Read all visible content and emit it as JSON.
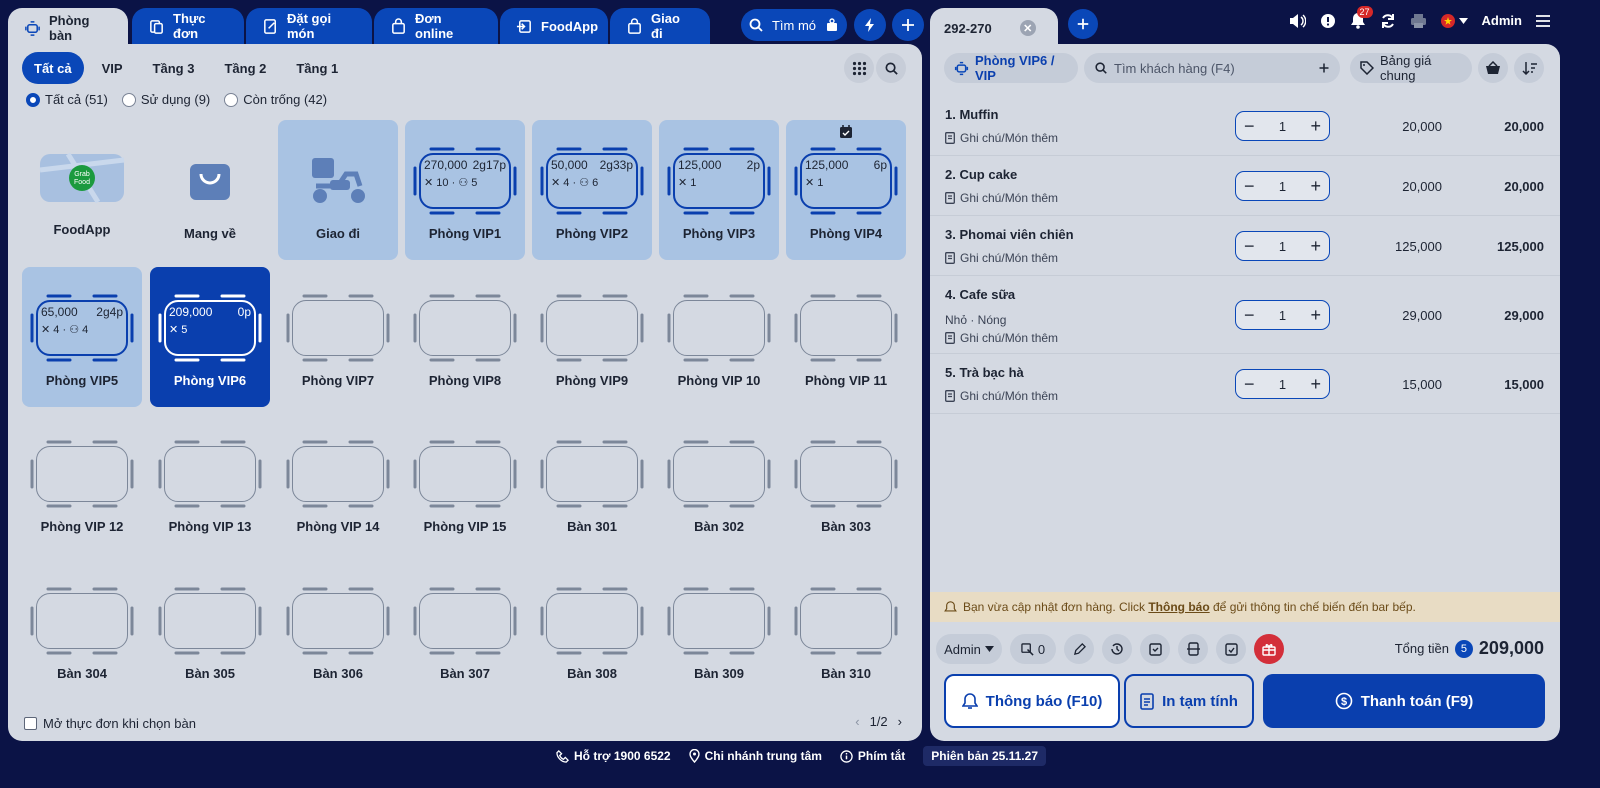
{
  "top_tabs": [
    {
      "label": "Phòng bàn",
      "icon": "table-icon"
    },
    {
      "label": "Thực đơn",
      "icon": "menu-icon"
    },
    {
      "label": "Đặt gọi món",
      "icon": "order-icon"
    },
    {
      "label": "Đơn online",
      "icon": "bag-icon"
    },
    {
      "label": "FoodApp",
      "icon": "login-icon"
    },
    {
      "label": "Giao đi",
      "icon": "bag-icon"
    }
  ],
  "search": {
    "label": "Tìm mó"
  },
  "floor_filters": [
    "Tất cả",
    "VIP",
    "Tầng 3",
    "Tầng 2",
    "Tầng 1"
  ],
  "status_filters": [
    {
      "label": "Tất cả (51)",
      "selected": true
    },
    {
      "label": "Sử dụng (9)",
      "selected": false
    },
    {
      "label": "Còn trống (42)",
      "selected": false
    }
  ],
  "special_cards": [
    {
      "name": "FoodApp",
      "icon": "grabfood-icon",
      "logo_text": "Grab Food"
    },
    {
      "name": "Mang về",
      "icon": "shopping-bag-icon"
    },
    {
      "name": "Giao đi",
      "icon": "scooter-icon"
    }
  ],
  "occupied_tables": [
    {
      "name": "Phòng VIP1",
      "amount": "270,000",
      "duration": "2g17p",
      "items": "10",
      "guests": "5"
    },
    {
      "name": "Phòng VIP2",
      "amount": "50,000",
      "duration": "2g33p",
      "items": "4",
      "guests": "6"
    },
    {
      "name": "Phòng VIP3",
      "amount": "125,000",
      "duration": "2p",
      "items": "1",
      "guests": ""
    },
    {
      "name": "Phòng VIP4",
      "amount": "125,000",
      "duration": "6p",
      "items": "1",
      "guests": ""
    },
    {
      "name": "Phòng VIP5",
      "amount": "65,000",
      "duration": "2g4p",
      "items": "4",
      "guests": "4"
    },
    {
      "name": "Phòng VIP6",
      "amount": "209,000",
      "duration": "0p",
      "items": "5",
      "guests": ""
    }
  ],
  "empty_tables": [
    "Phòng VIP7",
    "Phòng VIP8",
    "Phòng VIP9",
    "Phòng VIP 10",
    "Phòng VIP 11",
    "Phòng VIP 12",
    "Phòng VIP 13",
    "Phòng VIP 14",
    "Phòng VIP 15",
    "Bàn 301",
    "Bàn 302",
    "Bàn 303",
    "Bàn 304",
    "Bàn 305",
    "Bàn 306",
    "Bàn 307",
    "Bàn 308",
    "Bàn 309",
    "Bàn 310"
  ],
  "open_menu_checkbox": "Mở thực đơn khi chọn bàn",
  "pager": "1/2",
  "invoice": {
    "tab_label": "292-270",
    "room": "Phòng VIP6 / VIP",
    "customer_placeholder": "Tìm khách hàng (F4)",
    "price_list": "Bảng giá chung",
    "items": [
      {
        "name": "1. Muffin",
        "note": "Ghi chú/Món thêm",
        "modifiers": "",
        "qty": "1",
        "price": "20,000",
        "total": "20,000"
      },
      {
        "name": "2. Cup cake",
        "note": "Ghi chú/Món thêm",
        "modifiers": "",
        "qty": "1",
        "price": "20,000",
        "total": "20,000"
      },
      {
        "name": "3. Phomai viên chiên",
        "note": "Ghi chú/Món thêm",
        "modifiers": "",
        "qty": "1",
        "price": "125,000",
        "total": "125,000"
      },
      {
        "name": "4. Cafe sữa",
        "note": "Ghi chú/Món thêm",
        "modifiers": "Nhỏ · Nóng",
        "qty": "1",
        "price": "29,000",
        "total": "29,000"
      },
      {
        "name": "5. Trà bạc hà",
        "note": "Ghi chú/Món thêm",
        "modifiers": "",
        "qty": "1",
        "price": "15,000",
        "total": "15,000"
      }
    ],
    "notice_prefix": "Bạn vừa cập nhật đơn hàng. Click ",
    "notice_link": "Thông báo",
    "notice_suffix": " để gửi thông tin chế biến đến bar bếp.",
    "staff": "Admin",
    "guest_count": "0",
    "total_label": "Tổng tiền",
    "total_count": "5",
    "total_amount": "209,000",
    "btn_notify": "Thông báo (F10)",
    "btn_print": "In tạm tính",
    "btn_pay": "Thanh toán (F9)"
  },
  "header": {
    "user": "Admin",
    "notifications": "27"
  },
  "footer": {
    "support": "Hỗ trợ 1900 6522",
    "branch": "Chi nhánh trung tâm",
    "shortcuts": "Phím tắt",
    "version": "Phiên bản 25.11.27"
  },
  "colors": {
    "primary": "#0a47b8",
    "panel": "#d4d9e2",
    "background": "#0b1346",
    "occupied": "#a9c3e3",
    "danger": "#d32f3a"
  }
}
